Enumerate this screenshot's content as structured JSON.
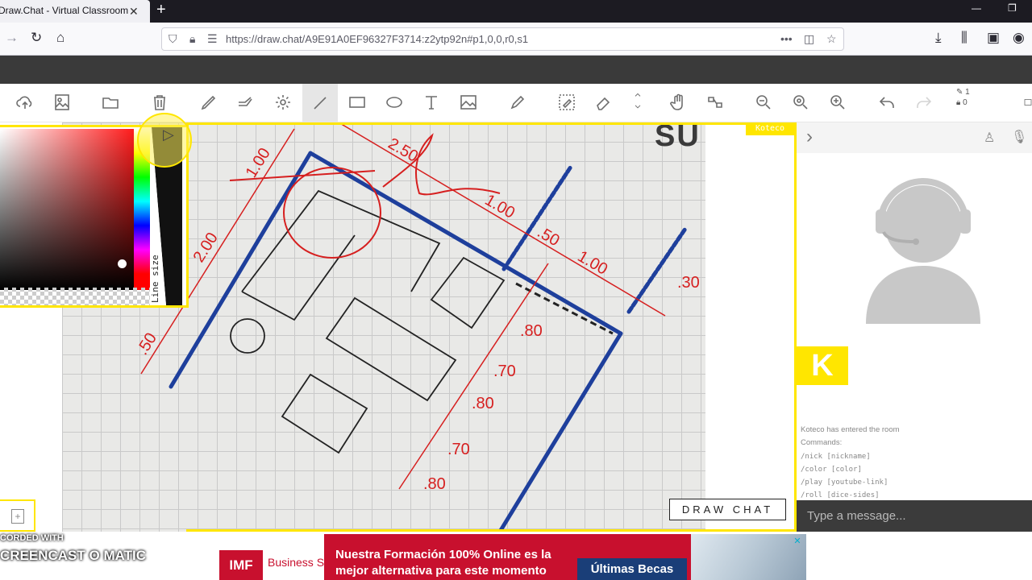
{
  "browser": {
    "tab_title": "Draw.Chat - Virtual Classroom",
    "url": "https://draw.chat/A9E91A0EF96327F3714:z2ytp92n#p1,0,0,r0,s1"
  },
  "toolbar": {
    "tools": [
      "upload-icon",
      "image-icon",
      "folder-icon",
      "trash-icon",
      "pencil-icon",
      "brush-icon",
      "settings-icon",
      "line-icon",
      "rectangle-icon",
      "ellipse-icon",
      "text-icon",
      "picture-icon",
      "marker-icon",
      "lasso-eraser-icon",
      "eraser-icon",
      "hand-icon",
      "move-icon",
      "zoom-out-icon",
      "zoom-fit-icon",
      "zoom-in-icon",
      "undo-icon",
      "redo-icon"
    ],
    "counter_top": "1",
    "counter_bottom": "0"
  },
  "colorpicker": {
    "line_size_label": "Line size",
    "selected_color": "#d61f1f"
  },
  "board": {
    "owner_tag": "Koteco",
    "logo_text": "DRAW CHAT"
  },
  "chat": {
    "user_initial": "K",
    "messages": [
      "Koteco has entered the room",
      "Commands:"
    ],
    "commands": [
      "/nick [nickname]",
      "/color [color]",
      "/play [youtube-link]",
      "/roll [dice-sides]"
    ],
    "input_placeholder": "Type a message..."
  },
  "recorder": {
    "line1": "CORDED WITH",
    "line2": "CREENCAST O MATIC"
  },
  "ad": {
    "logo": "IMF",
    "school": "Business School",
    "text_line1": "Nuestra Formación 100% Online es la",
    "text_line2": "mejor alternativa para este momento",
    "cta": "Últimas Becas"
  },
  "drawing_labels": [
    "1.00",
    "2.50",
    "1.00",
    ".50",
    "1.00",
    ".30",
    "2.00",
    ".50",
    ".80",
    ".70",
    ".80",
    ".70",
    ".80",
    "1"
  ]
}
